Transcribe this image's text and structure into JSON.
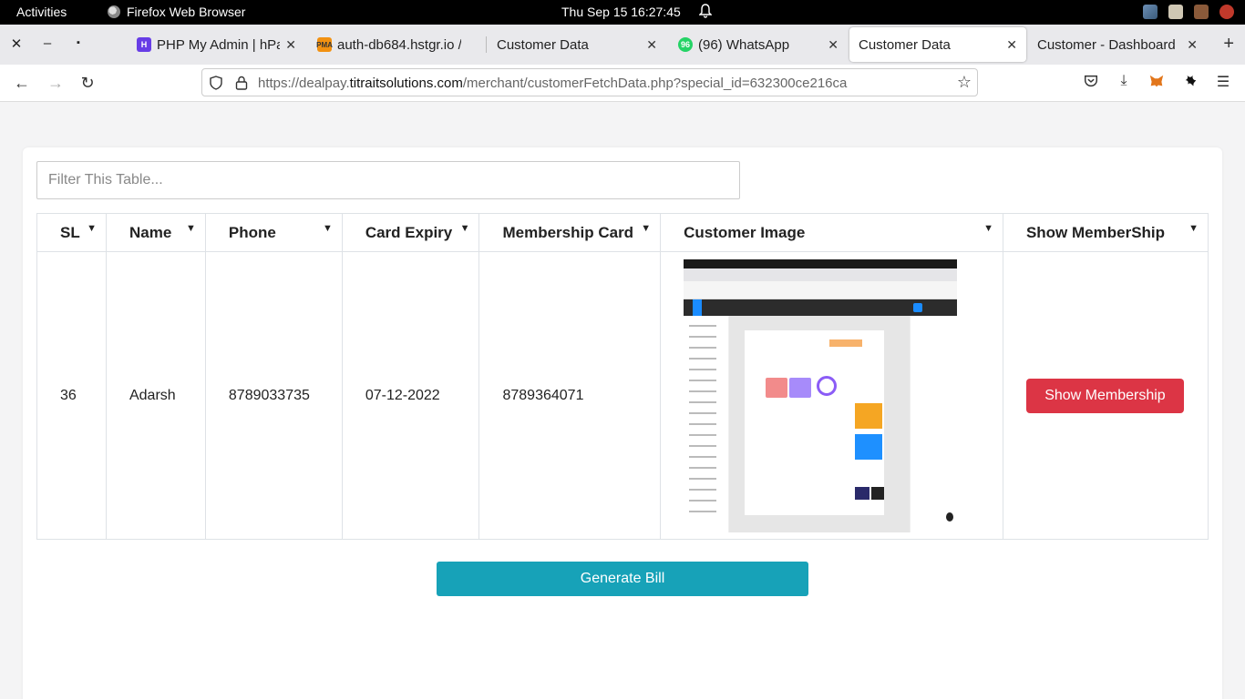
{
  "system_bar": {
    "activities": "Activities",
    "app_name": "Firefox Web Browser",
    "clock": "Thu Sep 15  16:27:45"
  },
  "browser": {
    "tabs": [
      {
        "title": "PHP My Admin | hPan",
        "favicon": "hostinger-icon",
        "active": false
      },
      {
        "title": "auth-db684.hstgr.io /",
        "favicon": "phpmyadmin-icon",
        "active": false
      },
      {
        "title": "Customer Data",
        "favicon": "none",
        "active": false
      },
      {
        "title": "(96) WhatsApp",
        "favicon": "whatsapp-icon",
        "badge": "96",
        "active": false
      },
      {
        "title": "Customer Data",
        "favicon": "none",
        "active": true
      },
      {
        "title": "Customer - Dashboard",
        "favicon": "none",
        "active": false
      }
    ],
    "url": {
      "prefix": "https://dealpay.",
      "domain": "titraitsolutions.com",
      "path": "/merchant/customerFetchData.php?special_id=632300ce216ca"
    }
  },
  "page": {
    "filter_placeholder": "Filter This Table...",
    "columns": [
      "SL",
      "Name",
      "Phone",
      "Card Expiry",
      "Membership Card",
      "Customer Image",
      "Show MemberShip"
    ],
    "rows": [
      {
        "sl": "36",
        "name": "Adarsh",
        "phone": "8789033735",
        "card_expiry": "07-12-2022",
        "membership_card": "8789364071",
        "image": "customer-screenshot-thumbnail",
        "action": "Show Membership"
      }
    ],
    "generate_bill": "Generate Bill"
  },
  "colors": {
    "danger": "#dc3545",
    "info": "#17a2b8"
  }
}
